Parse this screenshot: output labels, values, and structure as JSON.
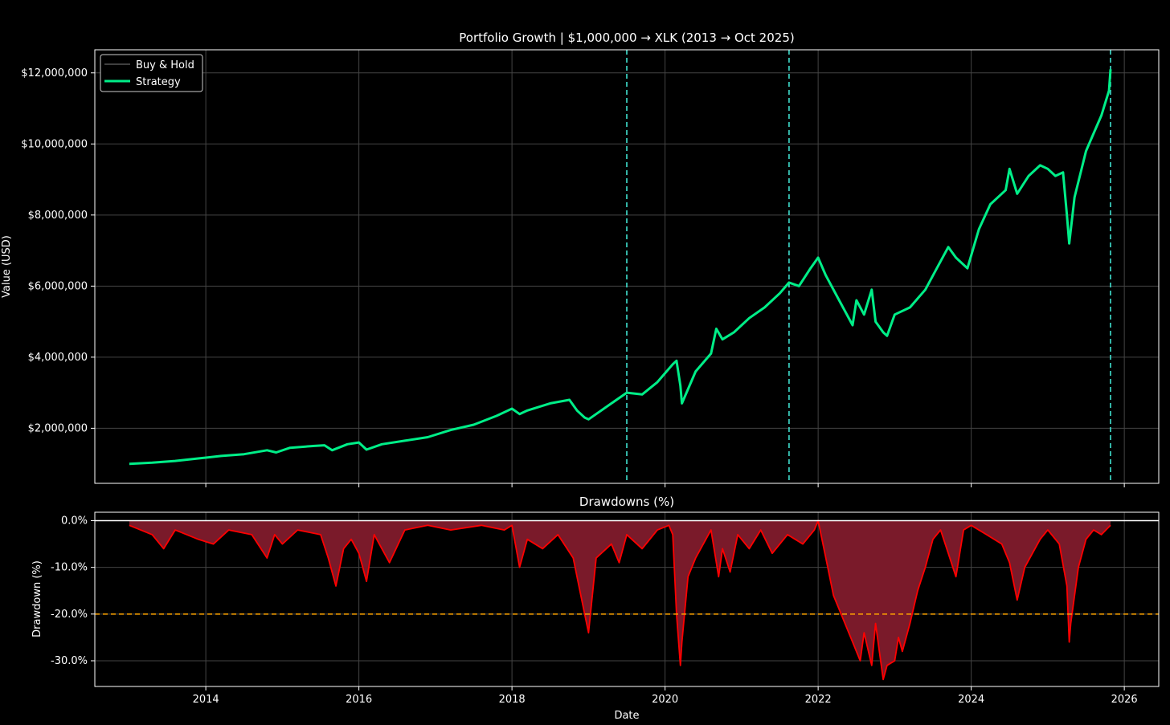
{
  "colors": {
    "background": "#000000",
    "strategy": "#00ee88",
    "buy_hold": "#555555",
    "event_line": "#40e0d0",
    "drawdown_line": "#ff0000",
    "drawdown_fill": "#7a1a2a",
    "threshold": "#ffa500",
    "grid": "#444444",
    "text": "#ffffff"
  },
  "chart_data": [
    {
      "type": "line",
      "title": "Portfolio Growth | $1,000,000 → XLK (2013 → Oct 2025)",
      "xlabel": "",
      "ylabel": "Value (USD)",
      "xlim": [
        2012.55,
        2026.45
      ],
      "ylim": [
        450000,
        12650000
      ],
      "grid": true,
      "legend_position": "top-left",
      "y_ticks": [
        2000000,
        4000000,
        6000000,
        8000000,
        10000000,
        12000000
      ],
      "y_tick_labels": [
        "$2,000,000",
        "$4,000,000",
        "$6,000,000",
        "$8,000,000",
        "$10,000,000",
        "$12,000,000"
      ],
      "x_ticks": [
        2014,
        2016,
        2018,
        2020,
        2022,
        2024,
        2026
      ],
      "vertical_markers": [
        2019.5,
        2021.62,
        2025.82
      ],
      "series": [
        {
          "name": "Buy & Hold",
          "x": [],
          "y": []
        },
        {
          "name": "Strategy",
          "x": [
            2013.0,
            2013.3,
            2013.6,
            2013.9,
            2014.2,
            2014.5,
            2014.8,
            2014.92,
            2015.1,
            2015.4,
            2015.55,
            2015.65,
            2015.85,
            2016.0,
            2016.1,
            2016.3,
            2016.6,
            2016.9,
            2017.2,
            2017.5,
            2017.8,
            2018.0,
            2018.1,
            2018.2,
            2018.5,
            2018.75,
            2018.85,
            2018.95,
            2019.0,
            2019.3,
            2019.5,
            2019.7,
            2019.9,
            2020.1,
            2020.15,
            2020.2,
            2020.22,
            2020.4,
            2020.6,
            2020.67,
            2020.75,
            2020.9,
            2021.1,
            2021.3,
            2021.5,
            2021.62,
            2021.75,
            2021.9,
            2022.0,
            2022.1,
            2022.3,
            2022.45,
            2022.5,
            2022.6,
            2022.7,
            2022.75,
            2022.85,
            2022.9,
            2023.0,
            2023.2,
            2023.4,
            2023.55,
            2023.7,
            2023.8,
            2023.95,
            2024.1,
            2024.25,
            2024.45,
            2024.5,
            2024.6,
            2024.75,
            2024.9,
            2025.0,
            2025.1,
            2025.2,
            2025.25,
            2025.28,
            2025.35,
            2025.5,
            2025.6,
            2025.7,
            2025.8,
            2025.82
          ],
          "y": [
            1000000,
            1030000,
            1080000,
            1150000,
            1220000,
            1270000,
            1380000,
            1320000,
            1450000,
            1500000,
            1520000,
            1380000,
            1550000,
            1600000,
            1400000,
            1550000,
            1650000,
            1750000,
            1950000,
            2100000,
            2350000,
            2550000,
            2400000,
            2500000,
            2700000,
            2800000,
            2500000,
            2300000,
            2250000,
            2700000,
            3000000,
            2950000,
            3300000,
            3800000,
            3900000,
            3200000,
            2700000,
            3600000,
            4100000,
            4800000,
            4500000,
            4700000,
            5100000,
            5400000,
            5800000,
            6100000,
            6000000,
            6500000,
            6800000,
            6300000,
            5500000,
            4900000,
            5600000,
            5200000,
            5900000,
            5000000,
            4700000,
            4600000,
            5200000,
            5400000,
            5900000,
            6500000,
            7100000,
            6800000,
            6500000,
            7600000,
            8300000,
            8700000,
            9300000,
            8600000,
            9100000,
            9400000,
            9300000,
            9100000,
            9200000,
            8000000,
            7200000,
            8500000,
            9800000,
            10300000,
            10800000,
            11500000,
            12100000
          ]
        }
      ]
    },
    {
      "type": "area",
      "title": "Drawdowns (%)",
      "xlabel": "Date",
      "ylabel": "Drawdown (%)",
      "xlim": [
        2012.55,
        2026.45
      ],
      "ylim": [
        -35.5,
        1.8
      ],
      "grid": true,
      "y_ticks": [
        0,
        -10,
        -20,
        -30
      ],
      "y_tick_labels": [
        "0.0%",
        "-10.0%",
        "-20.0%",
        "-30.0%"
      ],
      "x_ticks": [
        2014,
        2016,
        2018,
        2020,
        2022,
        2024,
        2026
      ],
      "x_tick_labels": [
        "2014",
        "2016",
        "2018",
        "2020",
        "2022",
        "2024",
        "2026"
      ],
      "threshold": -20,
      "series": [
        {
          "x": [
            2013.0,
            2013.3,
            2013.45,
            2013.6,
            2013.9,
            2014.1,
            2014.3,
            2014.6,
            2014.8,
            2014.9,
            2015.0,
            2015.2,
            2015.5,
            2015.6,
            2015.7,
            2015.8,
            2015.9,
            2016.0,
            2016.05,
            2016.1,
            2016.2,
            2016.4,
            2016.6,
            2016.9,
            2017.2,
            2017.6,
            2017.9,
            2018.0,
            2018.1,
            2018.2,
            2018.4,
            2018.6,
            2018.8,
            2018.9,
            2018.95,
            2019.0,
            2019.1,
            2019.3,
            2019.4,
            2019.5,
            2019.7,
            2019.9,
            2020.05,
            2020.1,
            2020.15,
            2020.2,
            2020.22,
            2020.3,
            2020.4,
            2020.6,
            2020.7,
            2020.75,
            2020.85,
            2020.95,
            2021.1,
            2021.25,
            2021.4,
            2021.6,
            2021.8,
            2021.95,
            2022.0,
            2022.1,
            2022.2,
            2022.3,
            2022.45,
            2022.55,
            2022.6,
            2022.7,
            2022.75,
            2022.8,
            2022.85,
            2022.9,
            2023.0,
            2023.05,
            2023.1,
            2023.2,
            2023.3,
            2023.4,
            2023.5,
            2023.6,
            2023.7,
            2023.8,
            2023.9,
            2024.0,
            2024.2,
            2024.4,
            2024.5,
            2024.6,
            2024.7,
            2024.9,
            2025.0,
            2025.15,
            2025.25,
            2025.28,
            2025.3,
            2025.4,
            2025.5,
            2025.6,
            2025.7,
            2025.82
          ],
          "y": [
            -1,
            -3,
            -6,
            -2,
            -4,
            -5,
            -2,
            -3,
            -8,
            -3,
            -5,
            -2,
            -3,
            -8,
            -14,
            -6,
            -4,
            -7,
            -10,
            -13,
            -3,
            -9,
            -2,
            -1,
            -2,
            -1,
            -2,
            -1,
            -10,
            -4,
            -6,
            -3,
            -8,
            -16,
            -20,
            -24,
            -8,
            -5,
            -9,
            -3,
            -6,
            -2,
            -1,
            -3,
            -20,
            -31,
            -26,
            -12,
            -8,
            -2,
            -12,
            -6,
            -11,
            -3,
            -6,
            -2,
            -7,
            -3,
            -5,
            -2,
            0,
            -8,
            -16,
            -20,
            -26,
            -30,
            -24,
            -31,
            -22,
            -28,
            -34,
            -31,
            -30,
            -25,
            -28,
            -22,
            -15,
            -10,
            -4,
            -2,
            -7,
            -12,
            -2,
            -1,
            -3,
            -5,
            -9,
            -17,
            -10,
            -4,
            -2,
            -5,
            -14,
            -26,
            -22,
            -10,
            -4,
            -2,
            -3,
            -1
          ]
        }
      ]
    }
  ]
}
